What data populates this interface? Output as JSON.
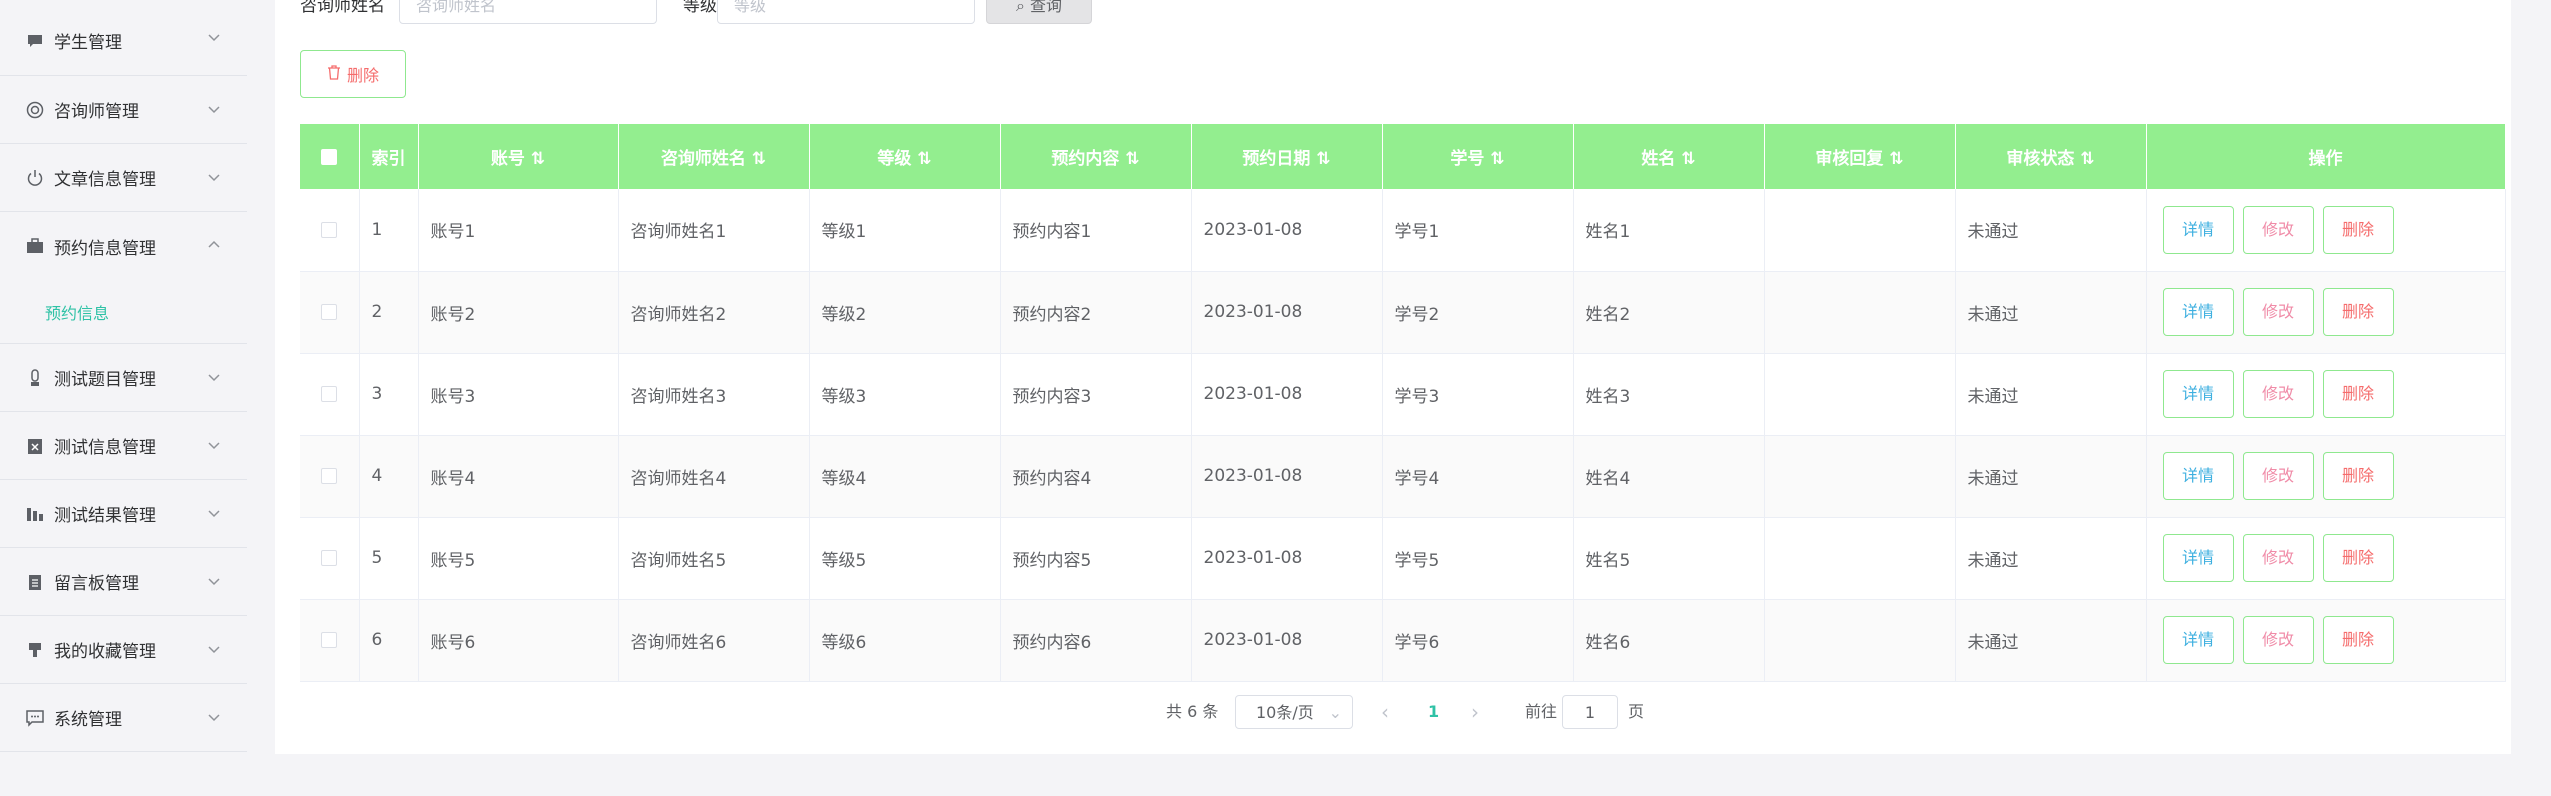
{
  "sidebar": {
    "items": [
      {
        "label": "学生管理",
        "icon": "chat-bubble-icon"
      },
      {
        "label": "咨询师管理",
        "icon": "life-ring-icon"
      },
      {
        "label": "文章信息管理",
        "icon": "power-icon"
      },
      {
        "label": "预约信息管理",
        "icon": "briefcase-icon",
        "open": true,
        "children": [
          {
            "label": "预约信息",
            "active": true
          }
        ]
      },
      {
        "label": "测试题目管理",
        "icon": "thermometer-icon"
      },
      {
        "label": "测试信息管理",
        "icon": "clipboard-x-icon"
      },
      {
        "label": "测试结果管理",
        "icon": "bar-chart-icon"
      },
      {
        "label": "留言板管理",
        "icon": "notepad-icon"
      },
      {
        "label": "我的收藏管理",
        "icon": "trophy-icon"
      },
      {
        "label": "系统管理",
        "icon": "message-square-icon"
      }
    ]
  },
  "search": {
    "counselor_label": "咨询师姓名",
    "counselor_placeholder": "咨询师姓名",
    "level_label": "等级",
    "level_placeholder": "等级",
    "query_button": "查询"
  },
  "toolbar": {
    "delete_label": "删除"
  },
  "table": {
    "headers": [
      "索引",
      "账号",
      "咨询师姓名",
      "等级",
      "预约内容",
      "预约日期",
      "学号",
      "姓名",
      "审核回复",
      "审核状态",
      "操作"
    ],
    "rows": [
      {
        "index": "1",
        "account": "账号1",
        "counselor": "咨询师姓名1",
        "level": "等级1",
        "content": "预约内容1",
        "date": "2023-01-08",
        "student_id": "学号1",
        "name": "姓名1",
        "reply": "",
        "status": "未通过"
      },
      {
        "index": "2",
        "account": "账号2",
        "counselor": "咨询师姓名2",
        "level": "等级2",
        "content": "预约内容2",
        "date": "2023-01-08",
        "student_id": "学号2",
        "name": "姓名2",
        "reply": "",
        "status": "未通过"
      },
      {
        "index": "3",
        "account": "账号3",
        "counselor": "咨询师姓名3",
        "level": "等级3",
        "content": "预约内容3",
        "date": "2023-01-08",
        "student_id": "学号3",
        "name": "姓名3",
        "reply": "",
        "status": "未通过"
      },
      {
        "index": "4",
        "account": "账号4",
        "counselor": "咨询师姓名4",
        "level": "等级4",
        "content": "预约内容4",
        "date": "2023-01-08",
        "student_id": "学号4",
        "name": "姓名4",
        "reply": "",
        "status": "未通过"
      },
      {
        "index": "5",
        "account": "账号5",
        "counselor": "咨询师姓名5",
        "level": "等级5",
        "content": "预约内容5",
        "date": "2023-01-08",
        "student_id": "学号5",
        "name": "姓名5",
        "reply": "",
        "status": "未通过"
      },
      {
        "index": "6",
        "account": "账号6",
        "counselor": "咨询师姓名6",
        "level": "等级6",
        "content": "预约内容6",
        "date": "2023-01-08",
        "student_id": "学号6",
        "name": "姓名6",
        "reply": "",
        "status": "未通过"
      }
    ],
    "actions": {
      "detail": "详情",
      "edit": "修改",
      "delete": "删除"
    }
  },
  "pagination": {
    "total_text": "共 6 条",
    "page_size": "10条/页",
    "current_page": "1",
    "goto_label": "前往",
    "goto_value": "1",
    "page_suffix": "页"
  },
  "colors": {
    "header_bg": "#93ee8f",
    "accent": "#2fc2a6",
    "danger": "#f56c6c"
  }
}
